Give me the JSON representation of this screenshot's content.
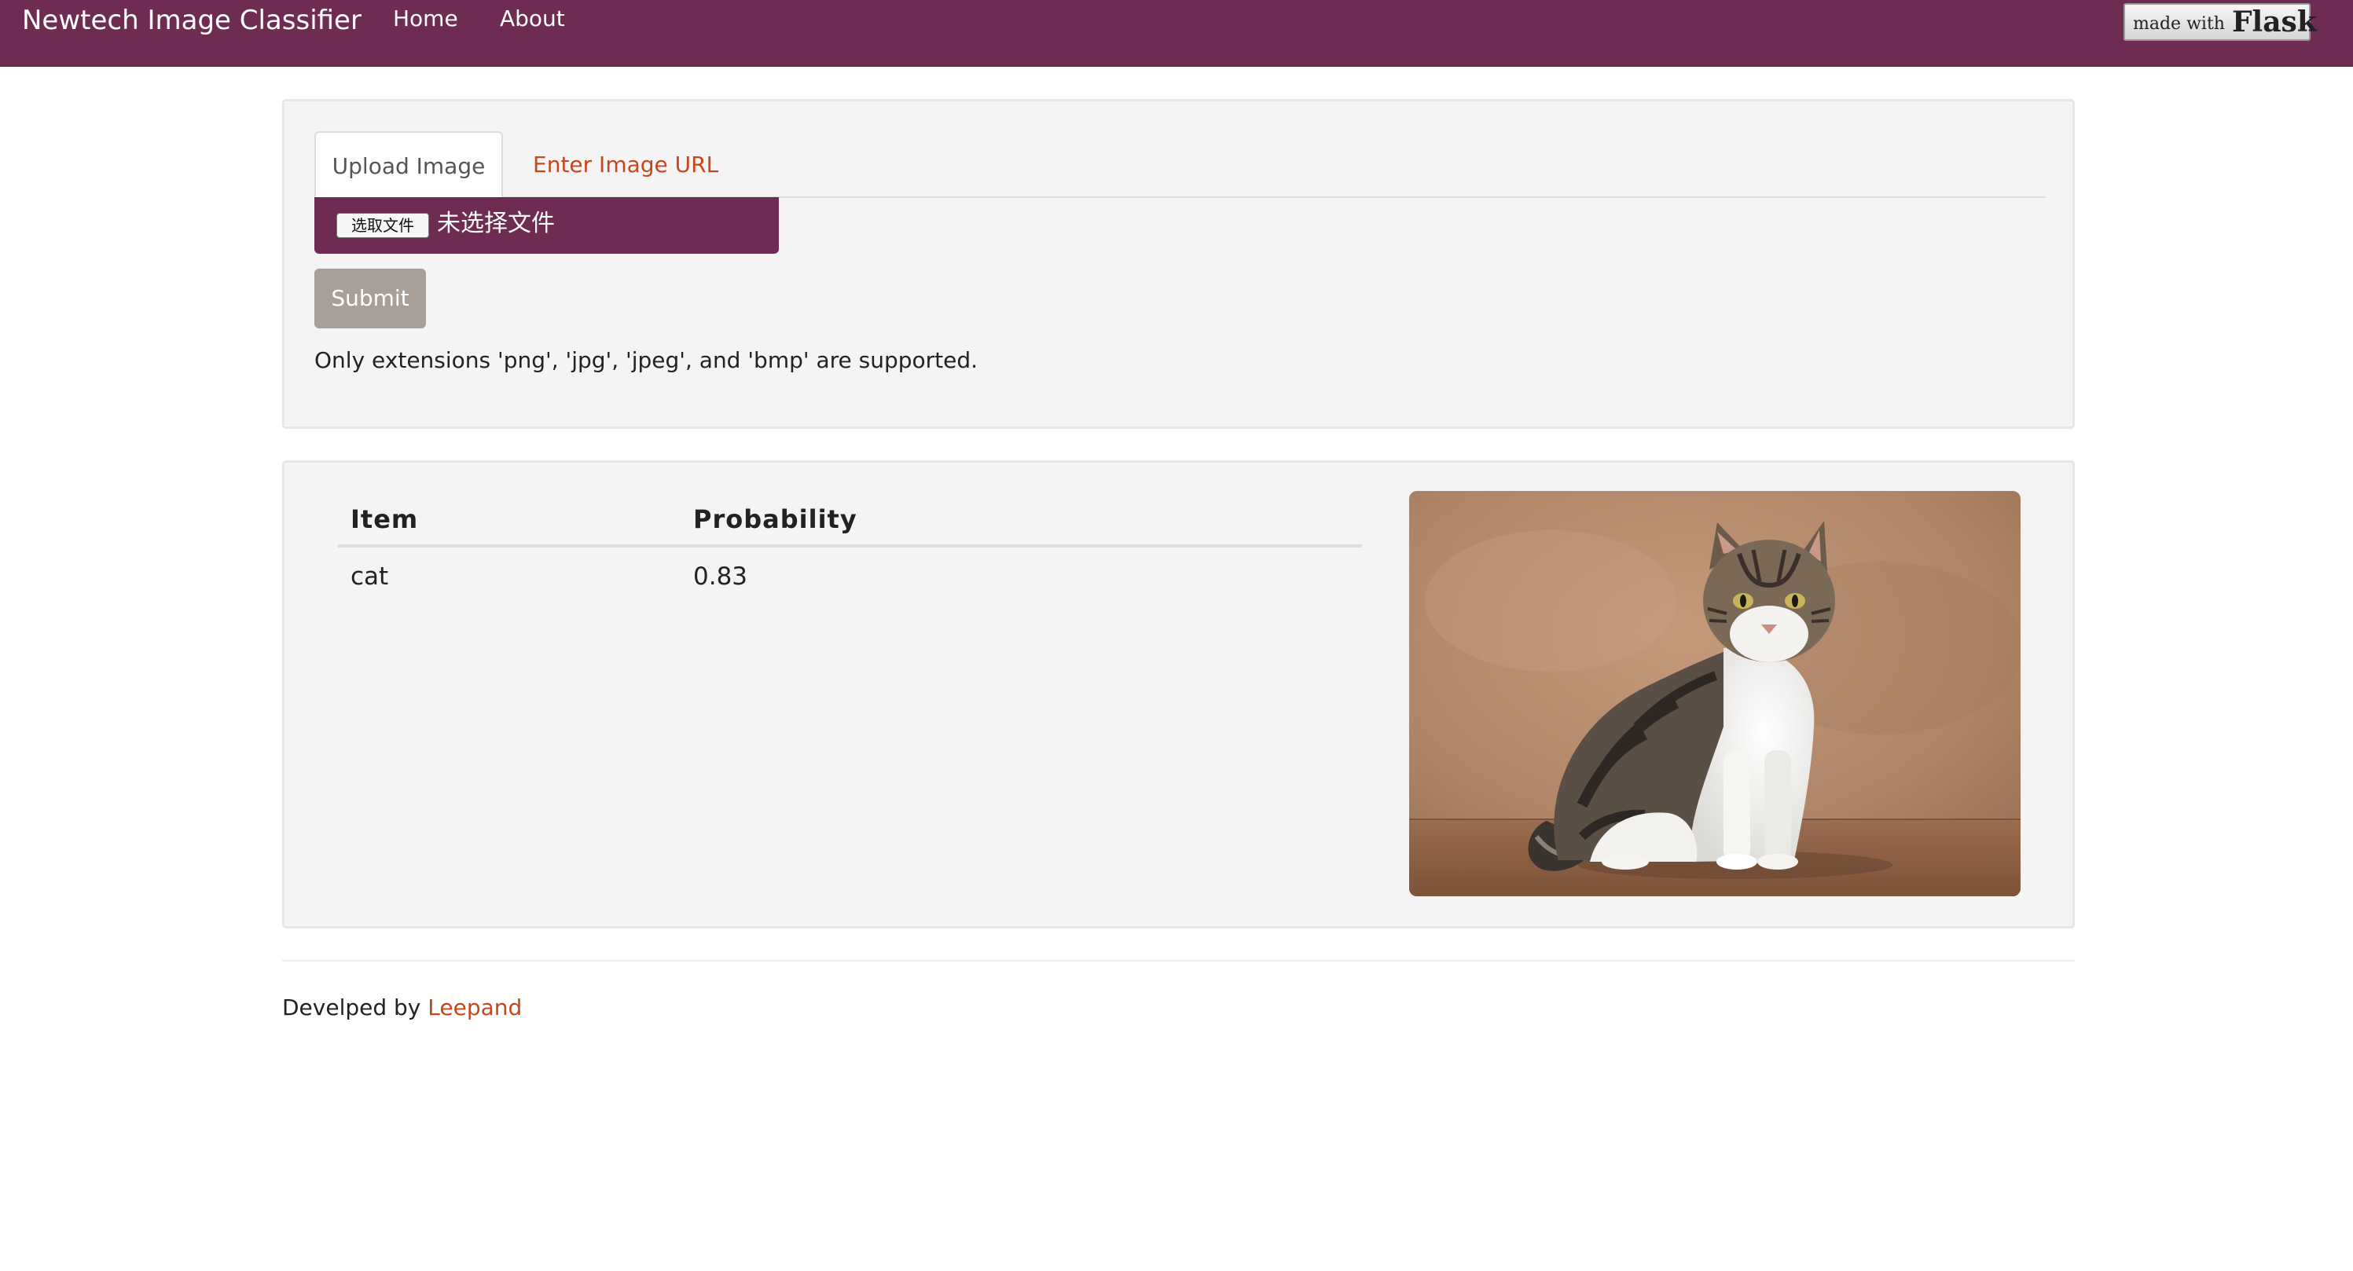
{
  "navbar": {
    "brand": "Newtech Image Classifier",
    "links": [
      "Home",
      "About"
    ],
    "badge": {
      "small": "made with",
      "big": "Flask"
    }
  },
  "upload": {
    "tabs": [
      {
        "label": "Upload Image",
        "active": true
      },
      {
        "label": "Enter Image URL",
        "active": false
      }
    ],
    "file_button": "选取文件",
    "file_status": "未选择文件",
    "submit_label": "Submit",
    "help_text": "Only extensions 'png', 'jpg', 'jpeg', and 'bmp' are supported."
  },
  "results": {
    "columns": [
      "Item",
      "Probability"
    ],
    "rows": [
      {
        "item": "cat",
        "probability": "0.83"
      }
    ]
  },
  "footer": {
    "prefix": "Develped by ",
    "author": "Leepand"
  },
  "colors": {
    "brand": "#6e2c53",
    "link": "#c9461d",
    "submit": "#a89f99",
    "panel": "#f4f4f4"
  }
}
